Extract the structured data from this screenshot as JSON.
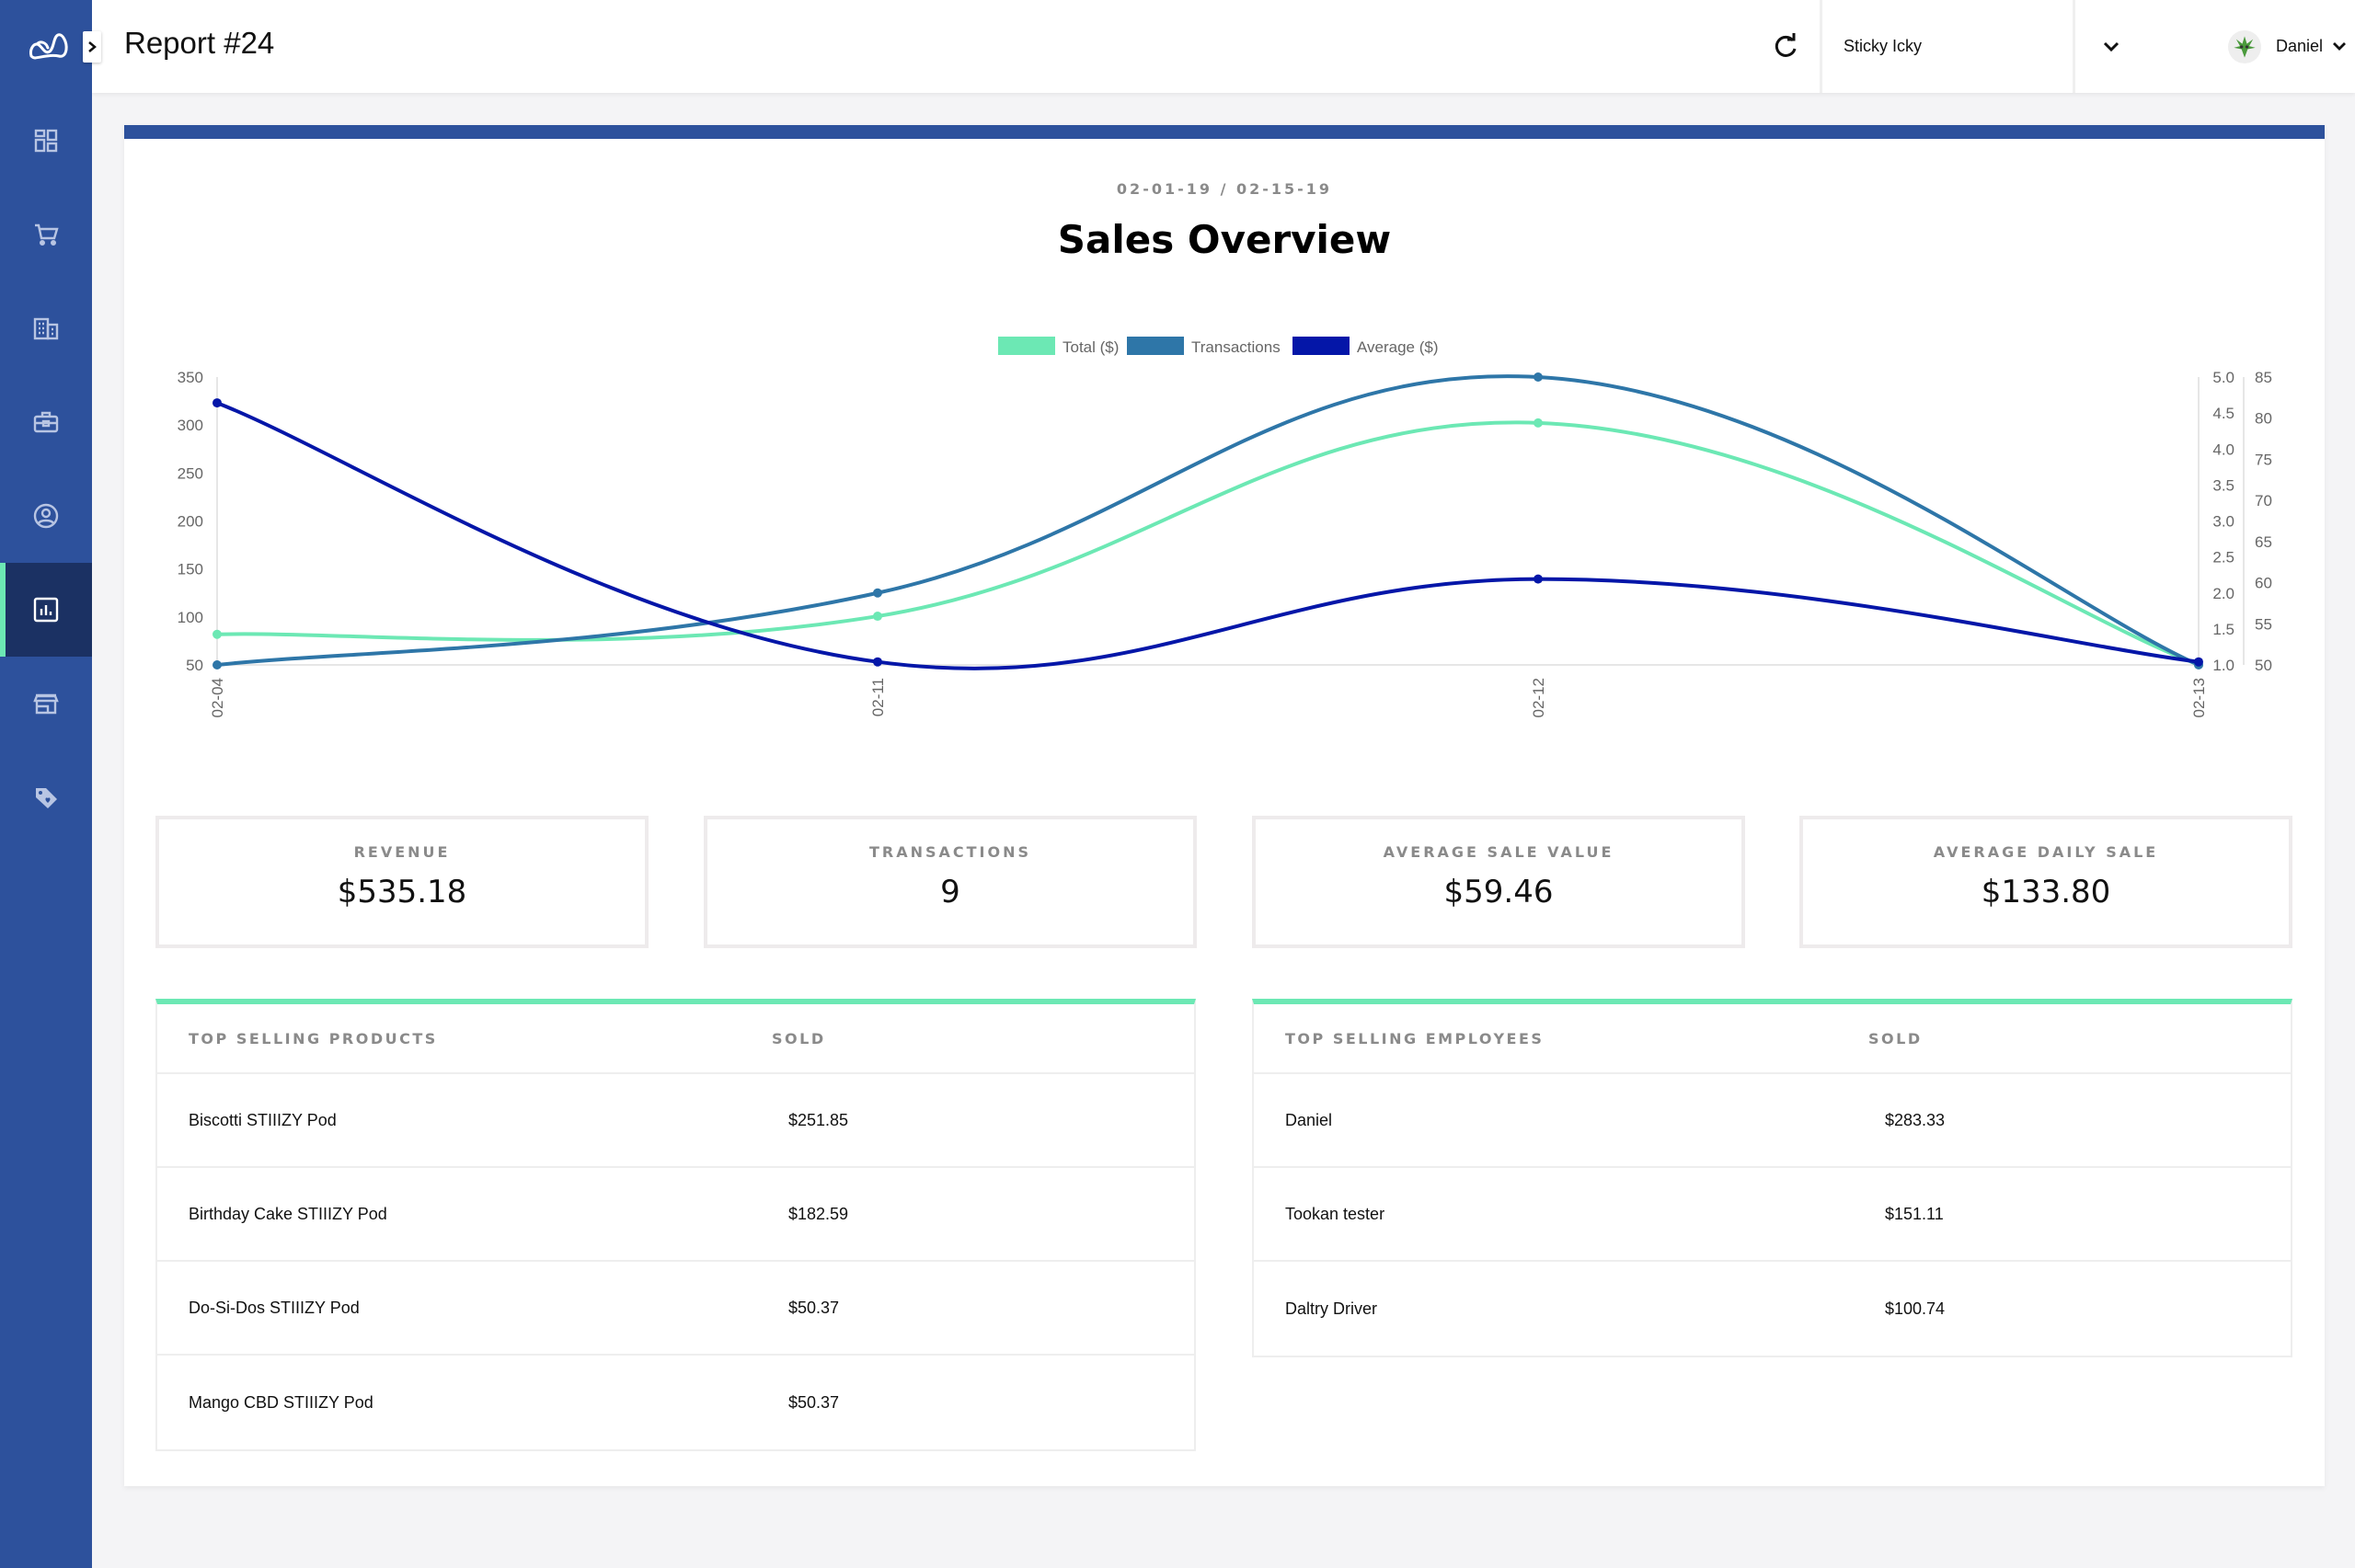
{
  "app": {
    "logo": "crown-logo",
    "collapse_icon": "chevron-right-icon"
  },
  "sidebar": {
    "items": [
      {
        "name": "dashboard",
        "icon": "dashboard-grid-icon",
        "active": false
      },
      {
        "name": "orders",
        "icon": "shopping-cart-icon",
        "active": false
      },
      {
        "name": "stores",
        "icon": "building-icon",
        "active": false
      },
      {
        "name": "inventory",
        "icon": "briefcase-icon",
        "active": false
      },
      {
        "name": "users",
        "icon": "user-circle-icon",
        "active": false
      },
      {
        "name": "reports",
        "icon": "bar-chart-icon",
        "active": true
      },
      {
        "name": "storefront",
        "icon": "storefront-icon",
        "active": false
      },
      {
        "name": "promotions",
        "icon": "tag-heart-icon",
        "active": false
      }
    ],
    "accent_color": "#6ce8b4",
    "bg_color": "#2d519c"
  },
  "header": {
    "title": "Report #24",
    "refresh_icon": "refresh-icon",
    "store_select": {
      "value": "Sticky Icky"
    },
    "user": {
      "name": "Daniel",
      "avatar": "cannabis-leaf-avatar"
    }
  },
  "report": {
    "date_range": "02-01-19 / 02-15-19",
    "title": "Sales Overview"
  },
  "chart_data": {
    "type": "line",
    "title": "Sales Overview",
    "x": [
      "02-04",
      "02-11",
      "02-12",
      "02-13"
    ],
    "legend_position": "top",
    "series": [
      {
        "name": "Total ($)",
        "color": "#6ce8b4",
        "axis": "left",
        "values": [
          81.86,
          100.74,
          302.21,
          50.37
        ]
      },
      {
        "name": "Transactions",
        "color": "#2e76a8",
        "axis": "right-inner",
        "values": [
          1,
          2,
          5,
          1
        ]
      },
      {
        "name": "Average ($)",
        "color": "#0416a8",
        "axis": "right-outer",
        "values": [
          81.86,
          50.37,
          60.44,
          50.37
        ]
      }
    ],
    "axes": {
      "left": {
        "range": [
          50,
          350
        ],
        "ticks": [
          "350",
          "300",
          "250",
          "200",
          "150",
          "100",
          "50"
        ]
      },
      "right_inner": {
        "range": [
          1.0,
          5.0
        ],
        "ticks": [
          "5.0",
          "4.5",
          "4.0",
          "3.5",
          "3.0",
          "2.5",
          "2.0",
          "1.5",
          "1.0"
        ]
      },
      "right_outer": {
        "range": [
          50,
          85
        ],
        "ticks": [
          "85",
          "80",
          "75",
          "70",
          "65",
          "60",
          "55",
          "50"
        ]
      }
    },
    "grid": false,
    "smooth": true
  },
  "stats": [
    {
      "label": "REVENUE",
      "value": "$535.18"
    },
    {
      "label": "TRANSACTIONS",
      "value": "9"
    },
    {
      "label": "AVERAGE SALE VALUE",
      "value": "$59.46"
    },
    {
      "label": "AVERAGE DAILY SALE",
      "value": "$133.80"
    }
  ],
  "products_table": {
    "headers": [
      "TOP SELLING PRODUCTS",
      "SOLD"
    ],
    "rows": [
      [
        "Biscotti STIIIZY Pod",
        "$251.85"
      ],
      [
        "Birthday Cake STIIIZY Pod",
        "$182.59"
      ],
      [
        "Do-Si-Dos STIIIZY Pod",
        "$50.37"
      ],
      [
        "Mango CBD STIIIZY Pod",
        "$50.37"
      ]
    ]
  },
  "employees_table": {
    "headers": [
      "TOP SELLING EMPLOYEES",
      "SOLD"
    ],
    "rows": [
      [
        "Daniel",
        "$283.33"
      ],
      [
        "Tookan tester",
        "$151.11"
      ],
      [
        "Daltry Driver",
        "$100.74"
      ]
    ]
  }
}
